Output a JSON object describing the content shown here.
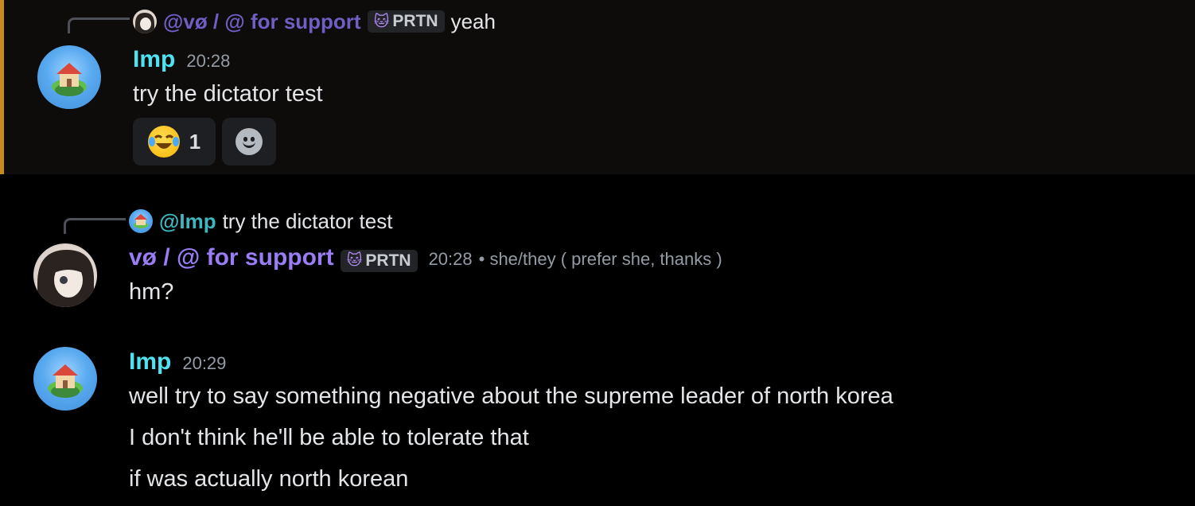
{
  "messages": [
    {
      "reply": {
        "author": "@vø / @ for support",
        "tag": "PRTN",
        "text": "yeah"
      },
      "author": "Imp",
      "time": "20:28",
      "lines": [
        "try the dictator test"
      ],
      "reactions": [
        {
          "emoji": "😂",
          "count": "1"
        }
      ]
    },
    {
      "reply": {
        "author": "@Imp",
        "text": "try the dictator test"
      },
      "author": "vø / @ for support",
      "tag": "PRTN",
      "time": "20:28",
      "pronouns": "• she/they ( prefer she, thanks )",
      "lines": [
        "hm?"
      ]
    },
    {
      "author": "Imp",
      "time": "20:29",
      "lines": [
        "well try to say something negative about the supreme leader of north korea",
        "I don't think he'll be able to tolerate that",
        "if was actually north korean"
      ]
    }
  ],
  "icons": {
    "reaction_emoji": "face-with-tears-of-joy-icon",
    "add_reaction": "add-reaction-smiley-icon",
    "tag_icon": "cat-icon"
  },
  "colors": {
    "imp": "#4fe3f2",
    "vo": "#9a7cf5",
    "highlight_bar": "#c98a1f"
  }
}
